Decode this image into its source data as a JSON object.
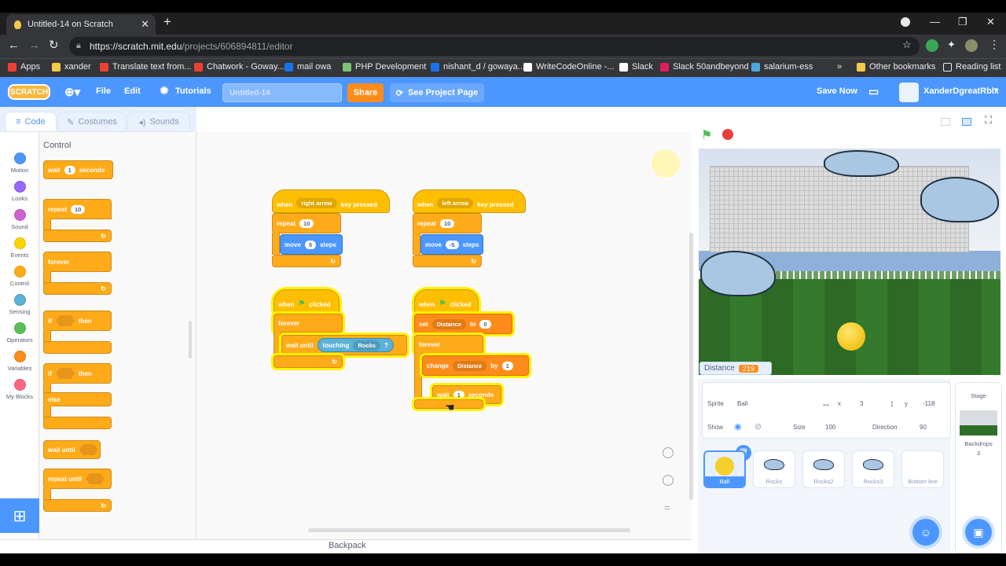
{
  "browser": {
    "tab_title": "Untitled-14 on Scratch",
    "url_host": "https://scratch.mit.edu",
    "url_path": "/projects/606894811/editor"
  },
  "bookmarks": [
    {
      "label": "Apps",
      "color": "#e94235"
    },
    {
      "label": "xander",
      "color": "#f4c84a"
    },
    {
      "label": "Translate text from...",
      "color": "#e94235"
    },
    {
      "label": "Chatwork - Goway...",
      "color": "#e94235"
    },
    {
      "label": "mail owa",
      "color": "#1a73e8"
    },
    {
      "label": "PHP Development",
      "color": "#7cc576"
    },
    {
      "label": "nishant_d / gowaya...",
      "color": "#1a73e8"
    },
    {
      "label": "WriteCodeOnline -...",
      "color": "#ffffff"
    },
    {
      "label": "Slack",
      "color": "#ffffff"
    },
    {
      "label": "Slack 50andbeyond",
      "color": "#e01e5a"
    },
    {
      "label": "salarium-ess",
      "color": "#4aa8d8"
    }
  ],
  "bookmarks_right": {
    "other": "Other bookmarks",
    "reading": "Reading list",
    "more": "»"
  },
  "menu": {
    "logo": "SCRATCH",
    "file": "File",
    "edit": "Edit",
    "tutorials": "Tutorials",
    "project_title": "Untitled-14",
    "share": "Share",
    "see_project": "See Project Page",
    "save_now": "Save Now",
    "username": "XanderDgreatRblx"
  },
  "editor_tabs": {
    "code": "Code",
    "costumes": "Costumes",
    "sounds": "Sounds"
  },
  "categories": [
    {
      "label": "Motion",
      "color": "#4c97ff"
    },
    {
      "label": "Looks",
      "color": "#9966ff"
    },
    {
      "label": "Sound",
      "color": "#cf63cf"
    },
    {
      "label": "Events",
      "color": "#ffd500"
    },
    {
      "label": "Control",
      "color": "#ffab19"
    },
    {
      "label": "Sensing",
      "color": "#5cb1d6"
    },
    {
      "label": "Operators",
      "color": "#59c059"
    },
    {
      "label": "Variables",
      "color": "#ff8c1a"
    },
    {
      "label": "My Blocks",
      "color": "#ff6680"
    }
  ],
  "palette": {
    "title": "Control",
    "wait": "wait",
    "wait_val": "1",
    "seconds": "seconds",
    "repeat": "repeat",
    "repeat_val": "10",
    "forever": "forever",
    "if": "if",
    "then": "then",
    "else": "else",
    "wait_until": "wait until",
    "repeat_until": "repeat until"
  },
  "scripts": {
    "s1": {
      "when": "when",
      "key": "right arrow",
      "key_pressed": "key pressed",
      "repeat": "repeat",
      "repeat_val": "10",
      "move": "move",
      "move_val": "5",
      "steps": "steps"
    },
    "s2": {
      "when": "when",
      "key": "left arrow",
      "key_pressed": "key pressed",
      "repeat": "repeat",
      "repeat_val": "10",
      "move": "move",
      "move_val": "-5",
      "steps": "steps"
    },
    "s3": {
      "when": "when",
      "clicked": "clicked",
      "forever": "forever",
      "wait_until": "wait until",
      "touching": "touching",
      "target": "Rocks",
      "q": "?"
    },
    "s4": {
      "when": "when",
      "clicked": "clicked",
      "set": "set",
      "var": "Distance",
      "to": "to",
      "set_val": "0",
      "forever": "forever",
      "change": "change",
      "by": "by",
      "change_val": "1",
      "wait": "wait",
      "wait_val": "1",
      "seconds": "seconds"
    }
  },
  "backpack": "Backpack",
  "stage": {
    "monitor_label": "Distance",
    "monitor_value": "219"
  },
  "sprite_info": {
    "sprite_label": "Sprite",
    "sprite_name": "Ball",
    "x_label": "x",
    "x_val": "3",
    "y_label": "y",
    "y_val": "-118",
    "show_label": "Show",
    "size_label": "Size",
    "size_val": "100",
    "direction_label": "Direction",
    "direction_val": "90"
  },
  "sprites": [
    {
      "name": "Ball"
    },
    {
      "name": "Rocks"
    },
    {
      "name": "Rocks2"
    },
    {
      "name": "Rocks3"
    },
    {
      "name": "Bottom line"
    }
  ],
  "stage_pane": {
    "title": "Stage",
    "backdrops_label": "Backdrops",
    "backdrops_count": "3"
  }
}
